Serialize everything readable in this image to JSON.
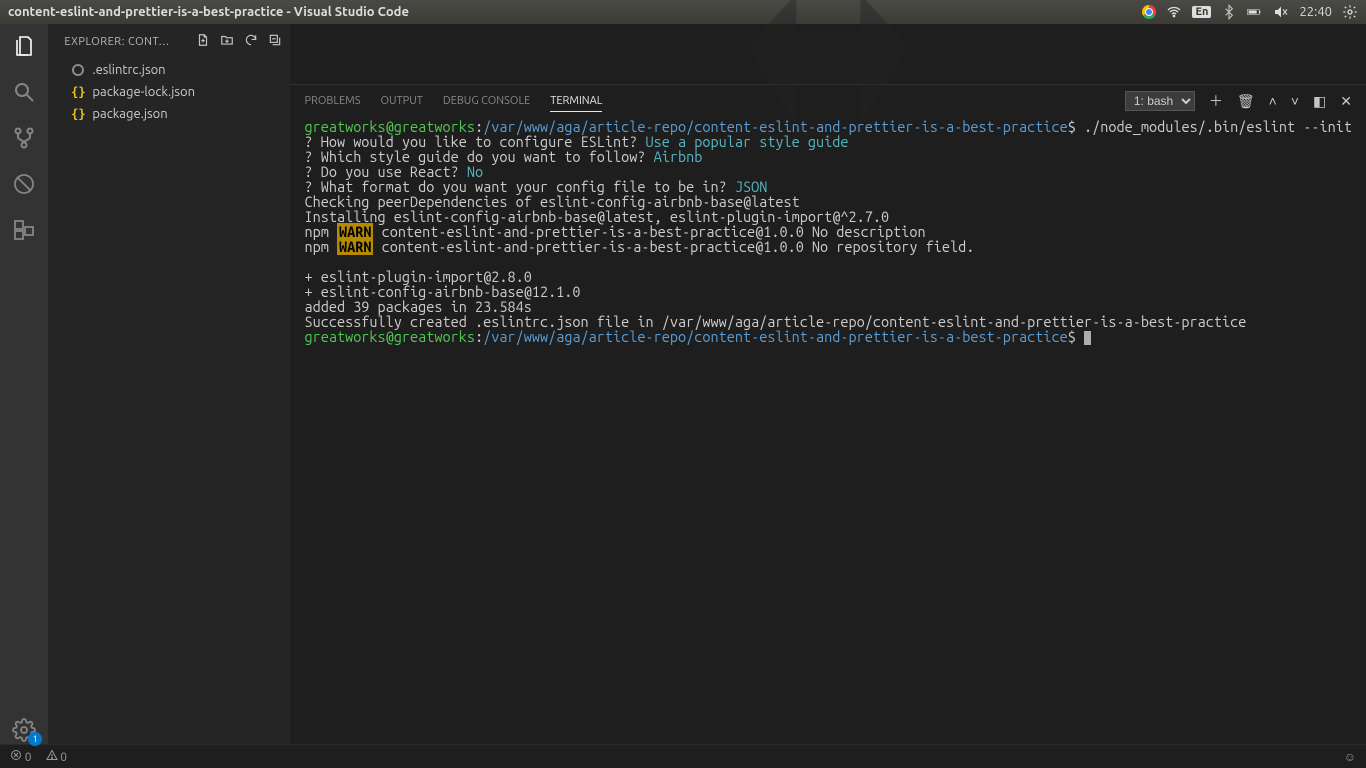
{
  "titlebar": {
    "title": "content-eslint-and-prettier-is-a-best-practice - Visual Studio Code",
    "lang": "En",
    "clock": "22:40"
  },
  "activitybar": {
    "settings_badge": "1"
  },
  "sidebar": {
    "header": "EXPLORER: CONT…",
    "files": [
      {
        "name": ".eslintrc.json",
        "icon": "eslint"
      },
      {
        "name": "package-lock.json",
        "icon": "json"
      },
      {
        "name": "package.json",
        "icon": "json"
      }
    ]
  },
  "panel": {
    "tabs": {
      "problems": "PROBLEMS",
      "output": "OUTPUT",
      "debug": "DEBUG CONSOLE",
      "terminal": "TERMINAL"
    },
    "terminal_selector": "1: bash"
  },
  "terminal": {
    "prompt_user": "greatworks@greatworks",
    "prompt_path": "/var/www/aga/article-repo/content-eslint-and-prettier-is-a-best-practice",
    "cmd1": "./node_modules/.bin/eslint --init",
    "q1": "? How would you like to configure ESLint? ",
    "a1": "Use a popular style guide",
    "q2": "? Which style guide do you want to follow? ",
    "a2": "Airbnb",
    "q3": "? Do you use React? ",
    "a3": "No",
    "q4": "? What format do you want your config file to be in? ",
    "a4": "JSON",
    "l1": "Checking peerDependencies of eslint-config-airbnb-base@latest",
    "l2": "Installing eslint-config-airbnb-base@latest, eslint-plugin-import@^2.7.0",
    "npm": "npm",
    "warn": "WARN",
    "w1": " content-eslint-and-prettier-is-a-best-practice@1.0.0 No description",
    "w2": " content-eslint-and-prettier-is-a-best-practice@1.0.0 No repository field.",
    "l3": "+ eslint-plugin-import@2.8.0",
    "l4": "+ eslint-config-airbnb-base@12.1.0",
    "l5": "added 39 packages in 23.584s",
    "l6": "Successfully created .eslintrc.json file in /var/www/aga/article-repo/content-eslint-and-prettier-is-a-best-practice"
  },
  "statusbar": {
    "errors": "0",
    "warnings": "0"
  }
}
